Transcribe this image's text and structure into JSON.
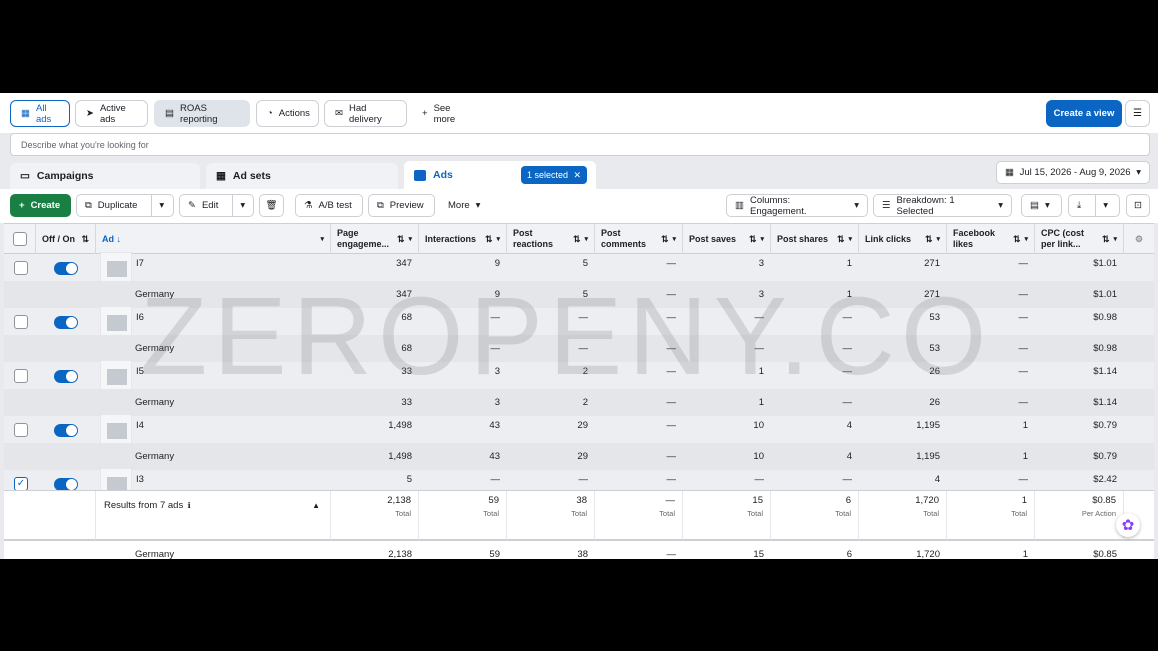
{
  "topbar": {
    "filters": [
      {
        "label": "All ads",
        "icon": "grid-icon"
      },
      {
        "label": "Active ads",
        "icon": "send-icon"
      },
      {
        "label": "ROAS reporting",
        "icon": "report-icon"
      },
      {
        "label": "Actions",
        "icon": "actions-icon"
      },
      {
        "label": "Had delivery",
        "icon": "delivery-icon"
      },
      {
        "label": "See more",
        "icon": "plus-icon"
      }
    ],
    "create_view": "Create a view"
  },
  "search": {
    "placeholder": "Describe what you're looking for"
  },
  "levels": {
    "campaigns": "Campaigns",
    "adsets": "Ad sets",
    "ads": "Ads",
    "selected_badge": "1 selected"
  },
  "date_range": "Jul 15, 2026 - Aug 9, 2026",
  "toolbar": {
    "create": "Create",
    "duplicate": "Duplicate",
    "edit": "Edit",
    "ab_test": "A/B test",
    "preview": "Preview",
    "more": "More",
    "columns": "Columns: Engagement.",
    "breakdown": "Breakdown: 1 Selected"
  },
  "table": {
    "headers": {
      "offon": "Off / On",
      "ad": "Ad",
      "page_engagement": "Page engageme...",
      "interactions": "Interactions",
      "post_reactions": "Post reactions",
      "post_comments": "Post comments",
      "post_saves": "Post saves",
      "post_shares": "Post shares",
      "link_clicks": "Link clicks",
      "fb_likes": "Facebook likes",
      "cpc": "CPC (cost per link..."
    },
    "rows": [
      {
        "name": "I7",
        "vals": [
          "347",
          "9",
          "5",
          "—",
          "3",
          "1",
          "271",
          "—",
          "$1.01"
        ]
      },
      {
        "name": "Germany",
        "vals": [
          "347",
          "9",
          "5",
          "—",
          "3",
          "1",
          "271",
          "—",
          "$1.01"
        ]
      },
      {
        "name": "I6",
        "vals": [
          "68",
          "—",
          "—",
          "—",
          "—",
          "—",
          "53",
          "—",
          "$0.98"
        ]
      },
      {
        "name": "Germany",
        "vals": [
          "68",
          "—",
          "—",
          "—",
          "—",
          "—",
          "53",
          "—",
          "$0.98"
        ]
      },
      {
        "name": "I5",
        "vals": [
          "33",
          "3",
          "2",
          "—",
          "1",
          "—",
          "26",
          "—",
          "$1.14"
        ]
      },
      {
        "name": "Germany",
        "vals": [
          "33",
          "3",
          "2",
          "—",
          "1",
          "—",
          "26",
          "—",
          "$1.14"
        ]
      },
      {
        "name": "I4",
        "vals": [
          "1,498",
          "43",
          "29",
          "—",
          "10",
          "4",
          "1,195",
          "1",
          "$0.79"
        ]
      },
      {
        "name": "Germany",
        "vals": [
          "1,498",
          "43",
          "29",
          "—",
          "10",
          "4",
          "1,195",
          "1",
          "$0.79"
        ]
      },
      {
        "name": "I3",
        "vals": [
          "5",
          "—",
          "—",
          "—",
          "—",
          "—",
          "4",
          "—",
          "$2.42"
        ]
      }
    ],
    "totals": {
      "label": "Results from 7 ads",
      "vals": [
        "2,138",
        "59",
        "38",
        "—",
        "15",
        "6",
        "1,720",
        "1",
        "$0.85"
      ],
      "subs": [
        "Total",
        "Total",
        "Total",
        "Total",
        "Total",
        "Total",
        "Total",
        "Total",
        "Per Action"
      ]
    },
    "final_row": {
      "name": "Germany",
      "vals": [
        "2,138",
        "59",
        "38",
        "—",
        "15",
        "6",
        "1,720",
        "1",
        "$0.85"
      ]
    }
  },
  "watermark": "ZEROPENY.CO",
  "colors": {
    "accent": "#0a66c2",
    "create_green": "#1a7f42"
  }
}
